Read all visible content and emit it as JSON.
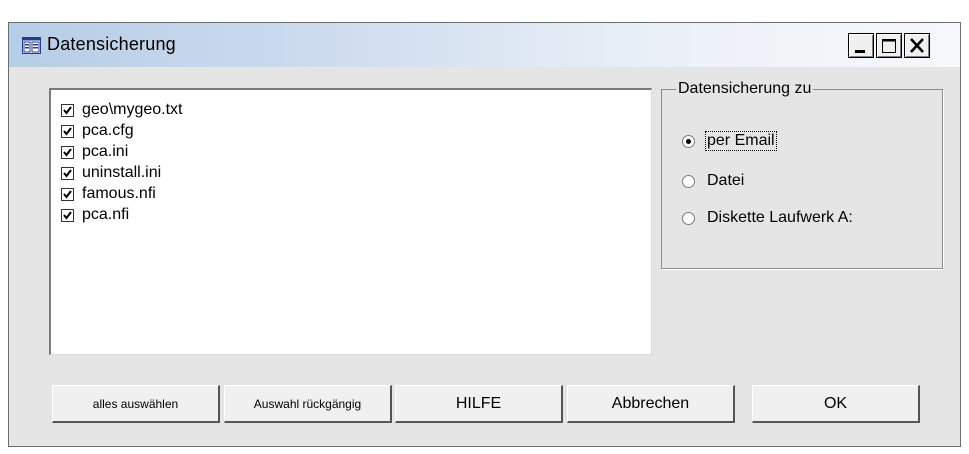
{
  "window": {
    "title": "Datensicherung"
  },
  "file_list": {
    "items": [
      {
        "label": "geo\\mygeo.txt",
        "checked": true
      },
      {
        "label": "pca.cfg",
        "checked": true
      },
      {
        "label": "pca.ini",
        "checked": true
      },
      {
        "label": "uninstall.ini",
        "checked": true
      },
      {
        "label": "famous.nfi",
        "checked": true
      },
      {
        "label": "pca.nfi",
        "checked": true
      }
    ]
  },
  "backup_target": {
    "legend": "Datensicherung zu",
    "options": [
      {
        "label": "per Email",
        "selected": true
      },
      {
        "label": "Datei",
        "selected": false
      },
      {
        "label": "Diskette Laufwerk A:",
        "selected": false
      }
    ]
  },
  "buttons": {
    "select_all": "alles auswählen",
    "undo_selection": "Auswahl rückgängig",
    "help": "HILFE",
    "cancel": "Abbrechen",
    "ok": "OK"
  }
}
